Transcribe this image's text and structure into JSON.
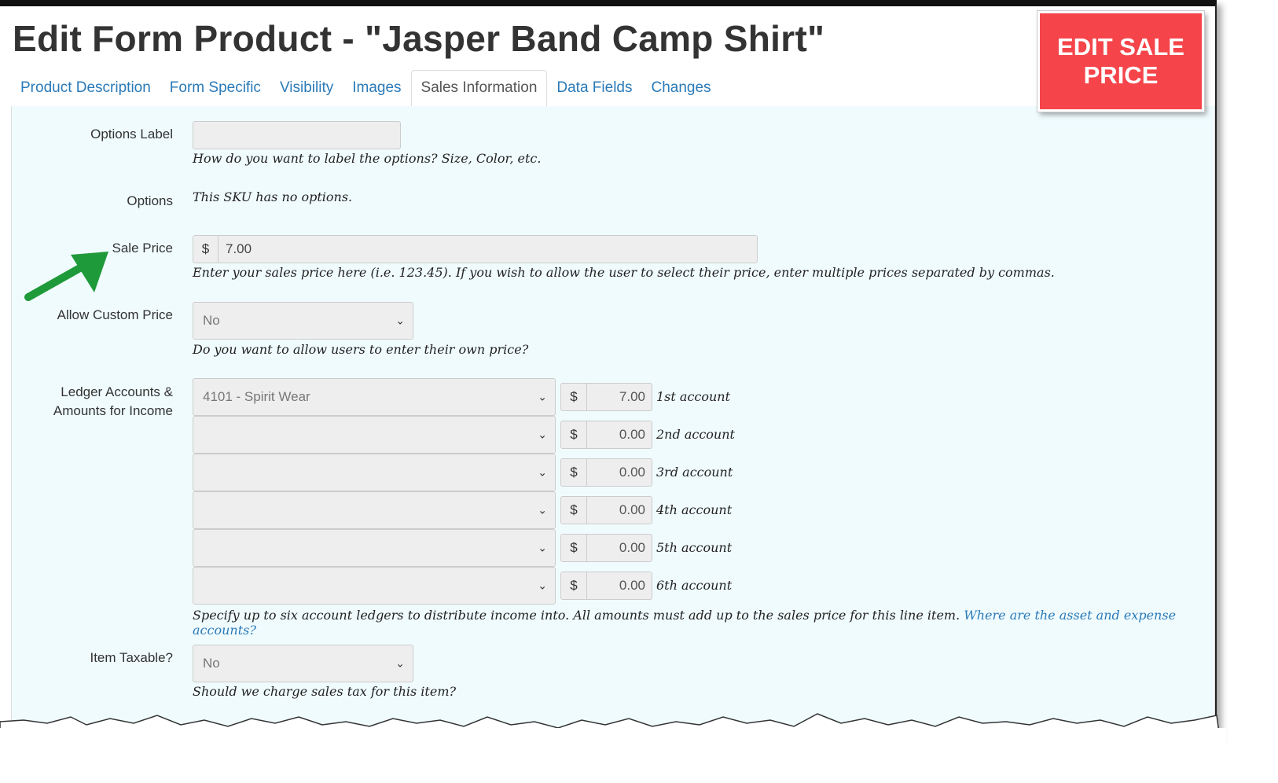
{
  "page_title": "Edit Form Product - \"Jasper Band Camp Shirt\"",
  "callout": "EDIT SALE PRICE",
  "tabs": [
    {
      "label": "Product Description"
    },
    {
      "label": "Form Specific"
    },
    {
      "label": "Visibility"
    },
    {
      "label": "Images"
    },
    {
      "label": "Sales Information",
      "active": true
    },
    {
      "label": "Data Fields"
    },
    {
      "label": "Changes"
    }
  ],
  "options_label": {
    "label": "Options Label",
    "value": "",
    "help": "How do you want to label the options? Size, Color, etc."
  },
  "options": {
    "label": "Options",
    "text": "This SKU has no options."
  },
  "sale_price": {
    "label": "Sale Price",
    "currency": "$",
    "value": "7.00",
    "help": "Enter your sales price here (i.e. 123.45). If you wish to allow the user to select their price, enter multiple prices separated by commas."
  },
  "allow_custom_price": {
    "label": "Allow Custom Price",
    "value": "No",
    "help": "Do you want to allow users to enter their own price?"
  },
  "ledger": {
    "label_line1": "Ledger Accounts &",
    "label_line2": "Amounts for Income",
    "accounts": [
      {
        "account": "4101 - Spirit Wear",
        "currency": "$",
        "amount": "7.00",
        "label": "1st account"
      },
      {
        "account": "",
        "currency": "$",
        "amount": "0.00",
        "label": "2nd account"
      },
      {
        "account": "",
        "currency": "$",
        "amount": "0.00",
        "label": "3rd account"
      },
      {
        "account": "",
        "currency": "$",
        "amount": "0.00",
        "label": "4th account"
      },
      {
        "account": "",
        "currency": "$",
        "amount": "0.00",
        "label": "5th account"
      },
      {
        "account": "",
        "currency": "$",
        "amount": "0.00",
        "label": "6th account"
      }
    ],
    "help": "Specify up to six account ledgers to distribute income into. All amounts must add up to the sales price for this line item.",
    "help_link": "Where are the asset and expense accounts?"
  },
  "item_taxable": {
    "label": "Item Taxable?",
    "value": "No",
    "help": "Should we charge sales tax for this item?"
  },
  "colors": {
    "accent_link": "#2a7ab8",
    "callout_bg": "#f5444a",
    "panel_bg": "#f0fbfe",
    "arrow": "#1f9a3a"
  },
  "icons": {
    "select_chevron": "chevron-down-icon",
    "annotation_arrow": "arrow-icon"
  }
}
